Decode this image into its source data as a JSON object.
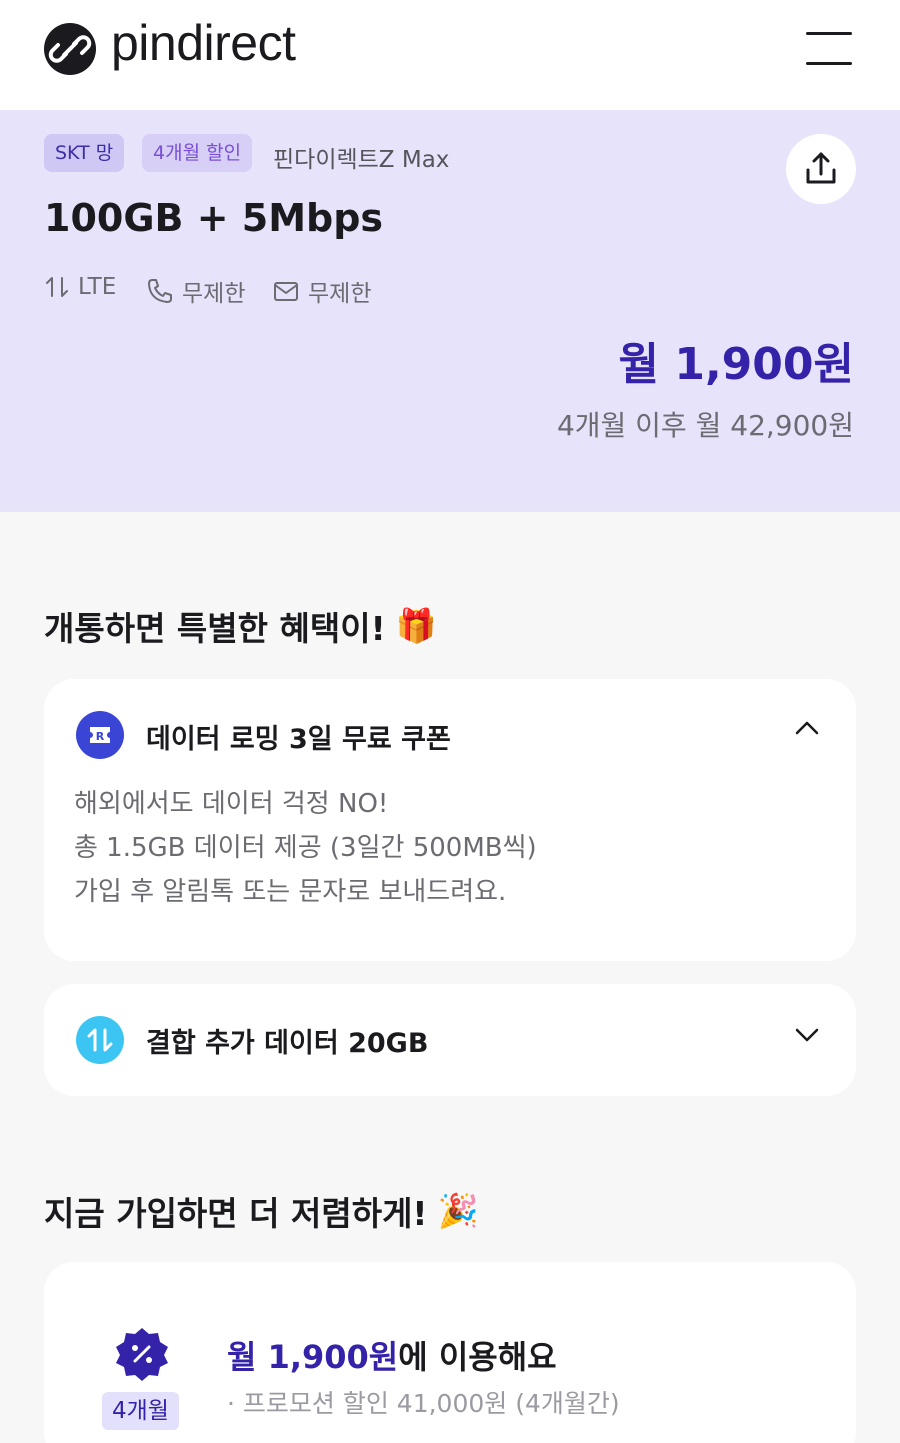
{
  "header": {
    "logo_text": "pindirect",
    "menu_icon": "hamburger-icon"
  },
  "plan": {
    "network_badge": "SKT 망",
    "discount_badge": "4개월 할인",
    "name": "핀다이렉트Z Max",
    "data": "100GB + 5Mbps",
    "specs": {
      "network": "LTE",
      "calls": "무제한",
      "sms": "무제한"
    },
    "price": "월 1,900원",
    "price_after": "4개월 이후 월 42,900원",
    "share_icon": "share-icon"
  },
  "benefits": {
    "title": "개통하면 특별한 혜택이!",
    "title_emoji": "🎁",
    "items": [
      {
        "title": "데이터 로밍 3일 무료 쿠폰",
        "icon": "roaming-ticket-icon",
        "expanded": true,
        "lines": [
          "해외에서도 데이터 걱정 NO!",
          "총 1.5GB 데이터 제공 (3일간 500MB씩)",
          "가입 후 알림톡 또는 문자로 보내드려요."
        ]
      },
      {
        "title": "결합 추가 데이터 20GB",
        "icon": "data-transfer-icon",
        "expanded": false
      }
    ]
  },
  "promo": {
    "title": "지금 가입하면 더 저렴하게!",
    "title_emoji": "🎉",
    "months_badge": "4개월",
    "line_highlight": "월 1,900원",
    "line_rest": "에 이용해요",
    "sub": "· 프로모션 할인 41,000원 (4개월간)"
  },
  "colors": {
    "accent": "#3423a8",
    "plan_bg": "#e6e3fa",
    "roaming_icon": "#3a45d6",
    "bundle_icon": "#3cc5f2"
  }
}
